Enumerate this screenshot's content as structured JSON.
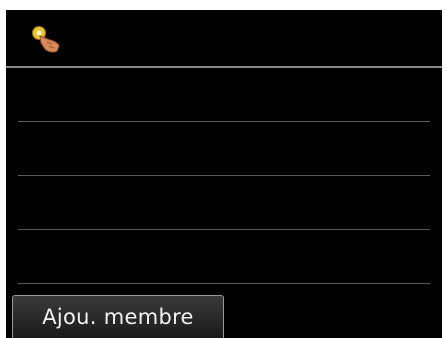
{
  "header": {
    "icon": "touch-hand-icon"
  },
  "list": {
    "rows": [
      "",
      "",
      "",
      ""
    ]
  },
  "footer": {
    "add_member_label": "Ajou. membre"
  },
  "colors": {
    "screen_bg": "#000000",
    "divider": "#8a8a8a",
    "row_line": "#5a5a5a",
    "button_text": "#f2f2f2"
  }
}
